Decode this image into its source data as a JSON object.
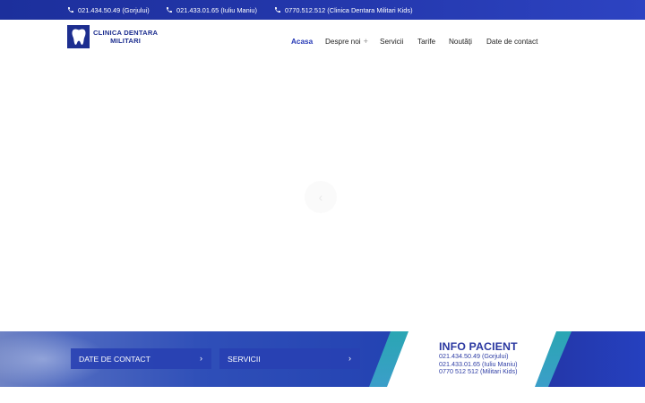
{
  "topbar": {
    "phones": [
      {
        "number": "021.434.50.49",
        "location": "(Gorjului)"
      },
      {
        "number": "021.433.01.65",
        "location": "(Iuliu Maniu)"
      },
      {
        "number": "0770.512.512",
        "location": "(Clinica Dentara Militari Kids)"
      }
    ]
  },
  "logo": {
    "line1": "CLINICA DENTARA",
    "line2": "MILITARI"
  },
  "nav": {
    "items": [
      "Acasa",
      "Despre noi",
      "Servicii",
      "Tarife",
      "Noutăți",
      "Date de contact"
    ],
    "submenu_icon": "+"
  },
  "hero": {
    "prev_icon": "‹"
  },
  "buttons": {
    "contact": "DATE DE CONTACT",
    "services": "SERVICII",
    "chevron": "›"
  },
  "info": {
    "title": "INFO PACIENT",
    "lines": [
      "021.434.50.49 (Gorjului)",
      "021.433.01.65 (Iuliu Maniu)",
      "0770 512 512 (Militari Kids)"
    ]
  },
  "colors": {
    "brand": "#1d2e8f",
    "accent": "#2639b6",
    "teal": "#2aa6b3"
  }
}
